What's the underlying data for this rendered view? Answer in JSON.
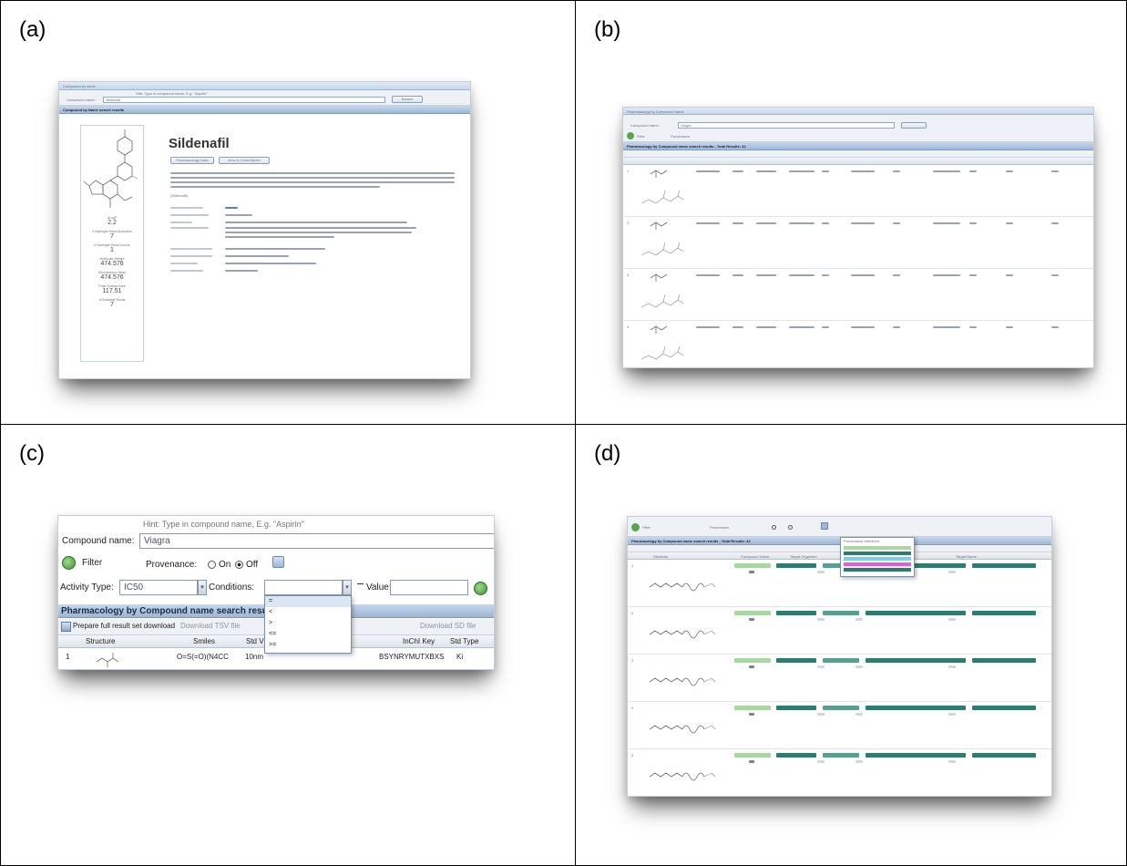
{
  "panels": {
    "a": {
      "label": "(a)",
      "search_panel_title": "Compound by name",
      "hint": "Hint: Type in compound name, E.g. \"Aspirin\"",
      "compound_name_label": "Compound name:",
      "compound_name_value": "Sildenafil",
      "search_button": "Search",
      "results_header": "Compound by Name search results",
      "compound_title": "Sildenafil",
      "buttons": [
        "Pharmacology Data",
        "View in ChemSpider"
      ],
      "description_tail": "(Sildenafil)",
      "properties": [
        {
          "label": "ALogP",
          "value": "2.2"
        },
        {
          "label": "# Hydrogen Bond Acceptors",
          "value": "7"
        },
        {
          "label": "# Hydrogen Bond Donors",
          "value": "1"
        },
        {
          "label": "Molecular Weight",
          "value": "474.576"
        },
        {
          "label": "Monoisotopic Mass",
          "value": "474.576"
        },
        {
          "label": "Polar Surface Area",
          "value": "117.51"
        },
        {
          "label": "# Rotatable Bonds",
          "value": "7"
        }
      ]
    },
    "b": {
      "label": "(b)",
      "title": "Pharmacology by Compound name",
      "compound_name_label": "Compound name:",
      "compound_name_value": "Viagra",
      "filter_label": "Filter",
      "provenance_label": "Provenance",
      "results_header": "Pharmacology by Compound name search results - Total Results: 42",
      "row_numbers": [
        "1",
        "2",
        "3",
        "4"
      ]
    },
    "c": {
      "label": "(c)",
      "hint": "Hint: Type in compound name, E.g. \"Aspirin\"",
      "compound_name_label": "Compound name:",
      "compound_name_value": "Viagra",
      "filter_label": "Filter",
      "provenance_label": "Provenance:",
      "provenance_on": "On",
      "provenance_off": "Off",
      "activity_type_label": "Activity Type:",
      "activity_type_value": "IC50",
      "conditions_label": "Conditions:",
      "value_label": "Value:",
      "conditions_options": [
        "=",
        "<",
        ">",
        "<=",
        ">="
      ],
      "results_header": "Pharmacology by Compound name search results - Total R",
      "toolbar_items": [
        "Prepare full result set download",
        "Download TSV file",
        "Download SD file"
      ],
      "columns": [
        "Structure",
        "Smiles",
        "Std V",
        "InChI Key",
        "Std Type"
      ],
      "row": {
        "index": "1",
        "smiles": "O=S(=O)(N4CC",
        "std_value": "10nm",
        "inchi_key": "BSYNRYMUTXBXS",
        "std_type": "Ki"
      }
    },
    "d": {
      "label": "(d)",
      "filter_label": "Filter",
      "provenance_label": "Provenance",
      "results_header": "Pharmacology by Compound name search results - Total Results: 42",
      "columns": [
        "Structure",
        "Compound Name",
        "Target Organism",
        "Target Name"
      ],
      "row_numbers": [
        "1",
        "2",
        "3",
        "4",
        "5"
      ],
      "legend_title": "Provenance reference"
    }
  }
}
